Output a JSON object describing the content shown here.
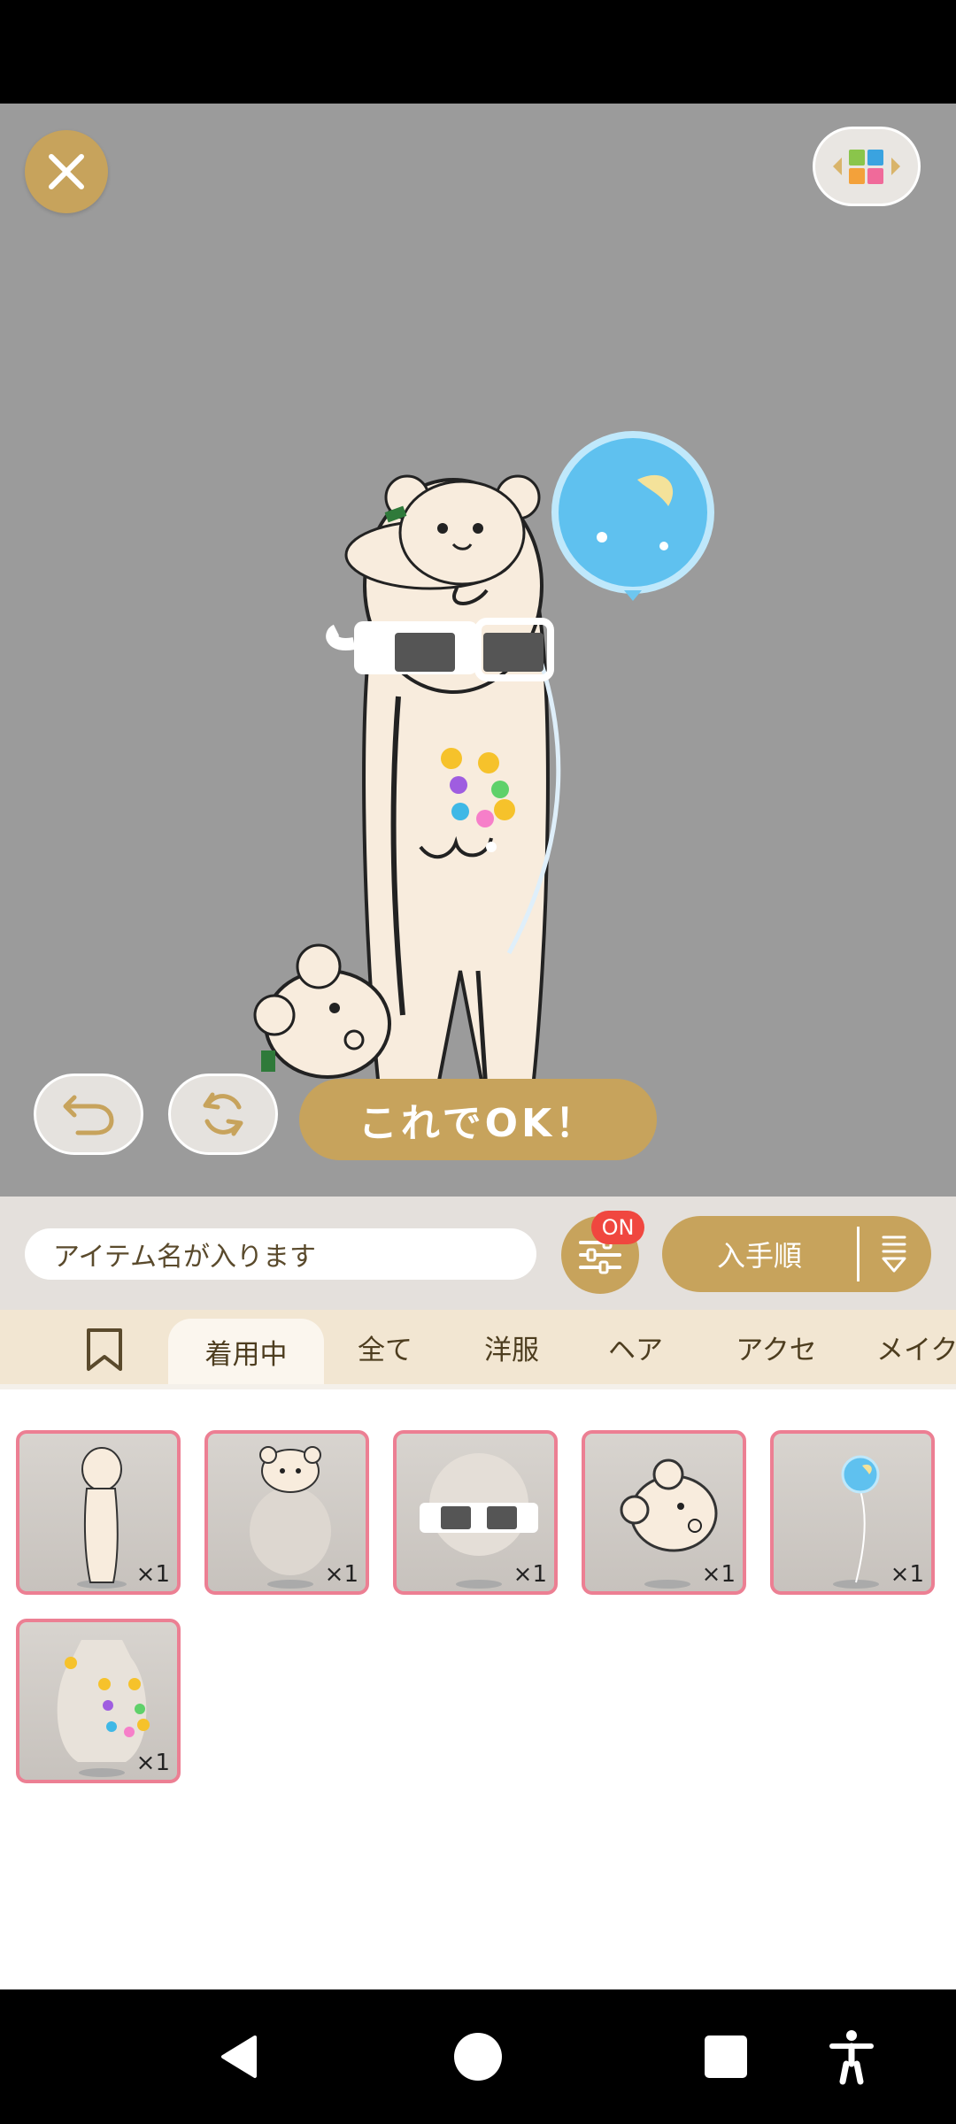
{
  "stage": {
    "ok_label": "これでOK！"
  },
  "toolbar": {
    "search_placeholder": "アイテム名が入ります",
    "filter_badge": "ON",
    "sort_label": "入手順"
  },
  "tabs": [
    {
      "label": "着用中",
      "active": true
    },
    {
      "label": "全て"
    },
    {
      "label": "洋服"
    },
    {
      "label": "ヘア"
    },
    {
      "label": "アクセ"
    },
    {
      "label": "メイク"
    }
  ],
  "items": [
    {
      "name": "body",
      "count": "×1"
    },
    {
      "name": "bear-on-head",
      "count": "×1"
    },
    {
      "name": "sunglasses",
      "count": "×1"
    },
    {
      "name": "bear-plush",
      "count": "×1"
    },
    {
      "name": "balloon",
      "count": "×1"
    },
    {
      "name": "ribbon-necklace",
      "count": "×1"
    }
  ],
  "colors": {
    "accent_gold": "#c7a35c",
    "badge_red": "#f0473f",
    "item_border": "#ec7f93",
    "stage_bg": "#9b9b9b"
  }
}
